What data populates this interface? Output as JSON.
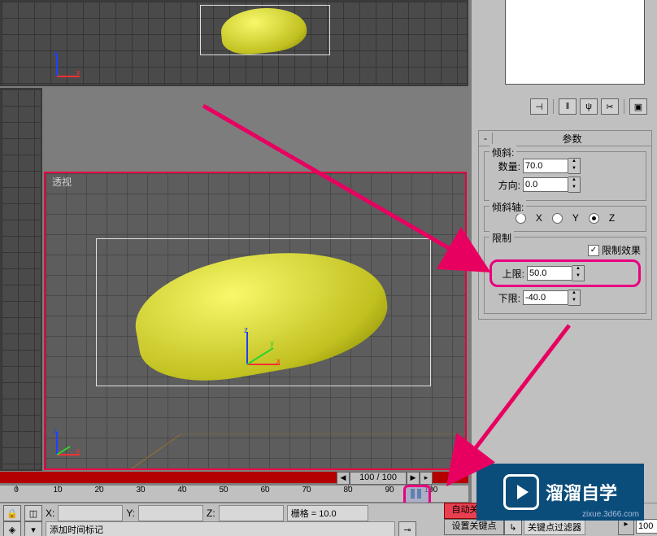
{
  "viewport": {
    "label_persp": "透视"
  },
  "timeline": {
    "current": 100,
    "total": 100,
    "display": "100 / 100",
    "ticks": [
      "0",
      "10",
      "20",
      "30",
      "40",
      "50",
      "60",
      "70",
      "80",
      "90",
      "100"
    ]
  },
  "panels": {
    "params_title": "参数",
    "tilt_grp": "倾斜:",
    "qty_label": "数量:",
    "qty_val": "70.0",
    "dir_label": "方向:",
    "dir_val": "0.0",
    "axis_grp": "倾斜轴:",
    "axis_x": "X",
    "axis_y": "Y",
    "axis_z": "Z",
    "limit_grp": "限制",
    "limit_chk": "限制效果",
    "upper_label": "上限:",
    "upper_val": "50.0",
    "lower_label": "下限:",
    "lower_val": "-40.0"
  },
  "status": {
    "x_label": "X:",
    "y_label": "Y:",
    "z_label": "Z:",
    "grid": "栅格 = 10.0",
    "add_marker": "添加时间标记",
    "auto_key": "自动关键点",
    "set_key": "设置关键点",
    "key_filter": "关键点过滤器",
    "frame_field": "100"
  },
  "watermark": {
    "text": "溜溜自学",
    "url": "zixue.3d66.com"
  }
}
